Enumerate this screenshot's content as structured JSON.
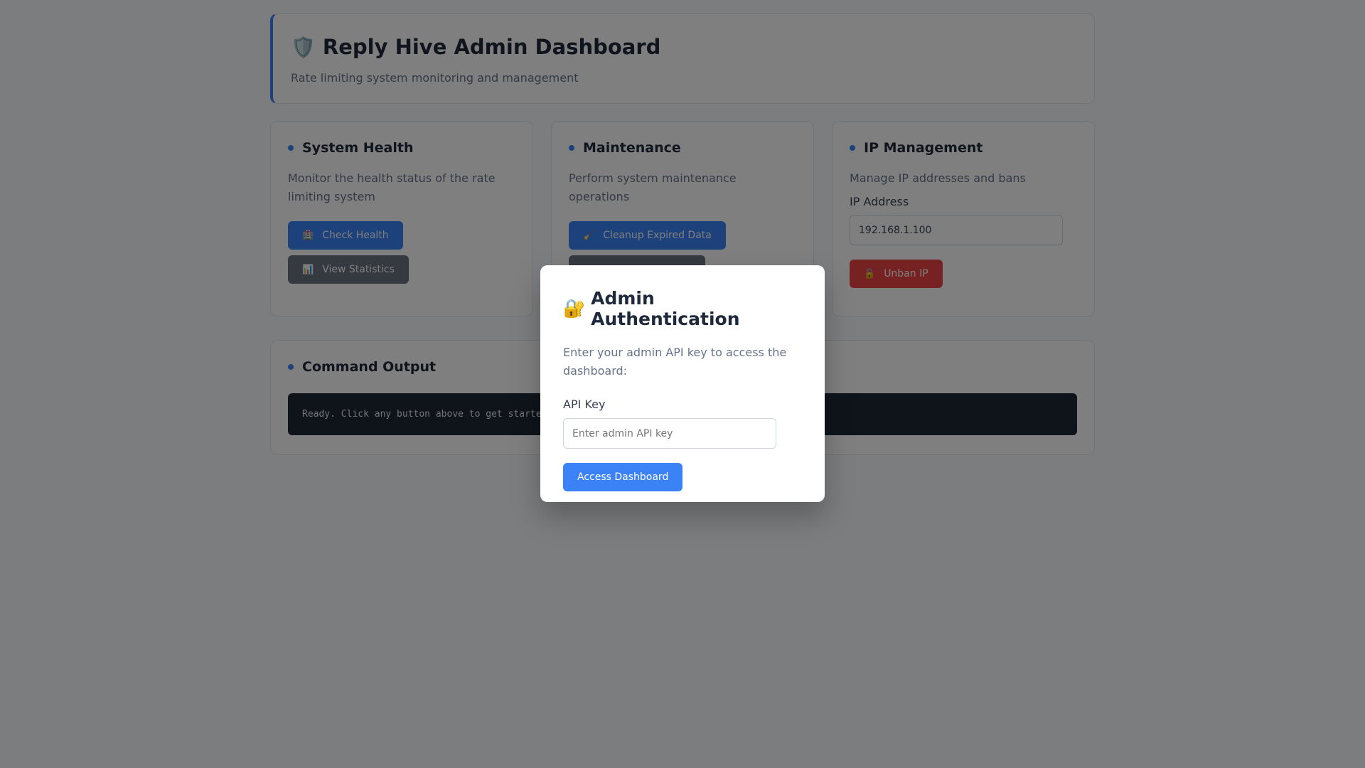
{
  "header": {
    "icon": "shield-icon",
    "emoji": "🛡️",
    "title": "Reply Hive Admin Dashboard",
    "subtitle": "Rate limiting system monitoring and management"
  },
  "cards": {
    "health": {
      "title": "System Health",
      "description": "Monitor the health status of the rate limiting system",
      "buttons": [
        {
          "icon": "hospital-icon",
          "emoji": "🏥",
          "label": "Check Health"
        },
        {
          "icon": "chart-icon",
          "emoji": "📊",
          "label": "View Statistics"
        }
      ]
    },
    "maintenance": {
      "title": "Maintenance",
      "description": "Perform system maintenance operations",
      "buttons": [
        {
          "icon": "broom-icon",
          "emoji": "🧹",
          "label": "Cleanup Expired Data"
        }
      ]
    },
    "ip": {
      "title": "IP Management",
      "description": "Manage IP addresses and bans",
      "field_label": "IP Address",
      "field_value": "192.168.1.100",
      "unban": {
        "icon": "unlock-icon",
        "emoji": "🔓",
        "label": "Unban IP"
      }
    }
  },
  "output": {
    "title": "Command Output",
    "text": "Ready. Click any button above to get started."
  },
  "modal": {
    "icon": "lock-key-icon",
    "emoji": "🔐",
    "title": "Admin Authentication",
    "description": "Enter your admin API key to access the dashboard:",
    "field_label": "API Key",
    "placeholder": "Enter admin API key",
    "submit": "Access Dashboard"
  },
  "colors": {
    "accent": "#3b82f6",
    "danger": "#ef4444",
    "secondary": "#6b7280",
    "terminal": "#1f2937"
  }
}
